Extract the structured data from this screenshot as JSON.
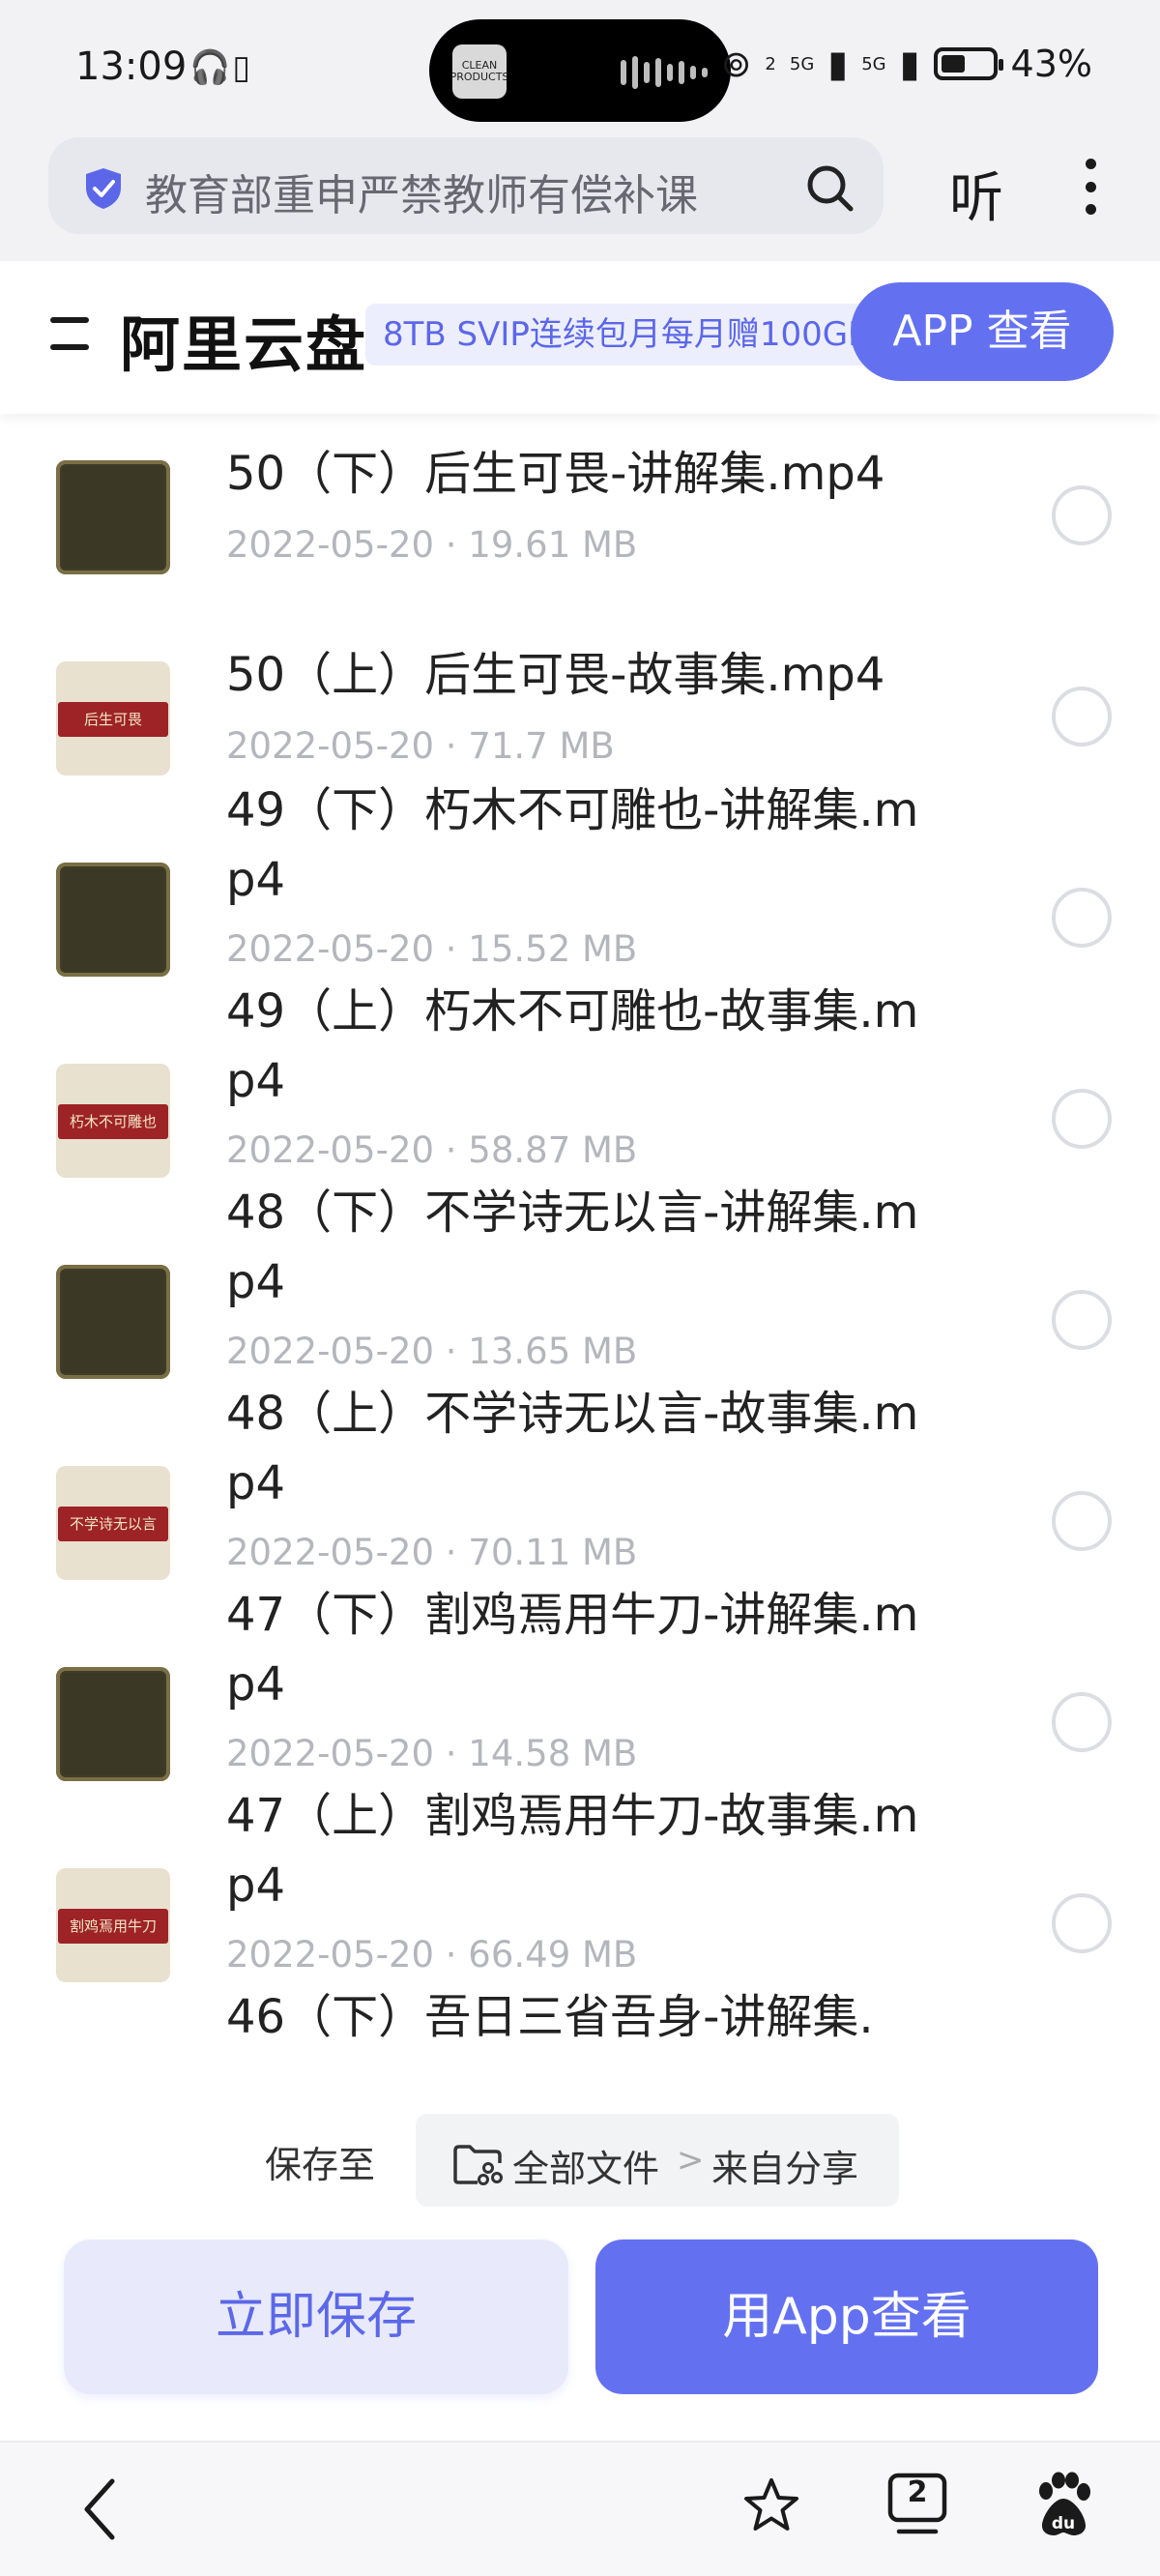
{
  "status_bar": {
    "time": "13:09",
    "left_icons": "🎧▯",
    "island_thumb_text": "CLEAN PRODUCTS",
    "signal1": "2",
    "signal2": "5G",
    "signal3": "5G",
    "battery": "43%"
  },
  "browser": {
    "search_text": "教育部重申严禁教师有偿补课",
    "listen_label": "听"
  },
  "header": {
    "app_title": "阿里云盘",
    "svip_badge": "8TB SVIP连续包月每月赠100GB",
    "app_view_button": "APP 查看"
  },
  "files": [
    {
      "name": "50（下）后生可畏-讲解集.mp4",
      "meta": "2022-05-20 · 19.61 MB",
      "thumb": "dark",
      "ribbon": ""
    },
    {
      "name": "50（上）后生可畏-故事集.mp4",
      "meta": "2022-05-20 · 71.7 MB",
      "thumb": "light",
      "ribbon": "后生可畏"
    },
    {
      "name": "49（下）朽木不可雕也-讲解集.mp4",
      "meta": "2022-05-20 · 15.52 MB",
      "thumb": "dark",
      "ribbon": ""
    },
    {
      "name": "49（上）朽木不可雕也-故事集.mp4",
      "meta": "2022-05-20 · 58.87 MB",
      "thumb": "light",
      "ribbon": "朽木不可雕也"
    },
    {
      "name": "48（下）不学诗无以言-讲解集.mp4",
      "meta": "2022-05-20 · 13.65 MB",
      "thumb": "dark",
      "ribbon": ""
    },
    {
      "name": "48（上）不学诗无以言-故事集.mp4",
      "meta": "2022-05-20 · 70.11 MB",
      "thumb": "light",
      "ribbon": "不学诗无以言"
    },
    {
      "name": "47（下）割鸡焉用牛刀-讲解集.mp4",
      "meta": "2022-05-20 · 14.58 MB",
      "thumb": "dark",
      "ribbon": ""
    },
    {
      "name": "47（上）割鸡焉用牛刀-故事集.mp4",
      "meta": "2022-05-20 · 66.49 MB",
      "thumb": "light",
      "ribbon": "割鸡焉用牛刀"
    },
    {
      "name": "46（下）吾日三省吾身-讲解集.",
      "meta": "",
      "thumb": "none",
      "ribbon": ""
    }
  ],
  "save_path": {
    "label": "保存至",
    "all_files": "全部文件",
    "separator": ">",
    "from_share": "来自分享"
  },
  "actions": {
    "save_now": "立即保存",
    "open_in_app": "用App查看"
  },
  "bottom_nav": {
    "tab_count": "2"
  },
  "colors": {
    "accent": "#6371f1",
    "accent_light": "#e8eafc",
    "meta_gray": "#b4b6bc"
  },
  "icons": [
    "shield-icon",
    "search-icon",
    "more-icon",
    "menu-icon",
    "folder-icon",
    "back-icon",
    "star-icon",
    "tabs-icon",
    "baidu-paw-icon"
  ]
}
